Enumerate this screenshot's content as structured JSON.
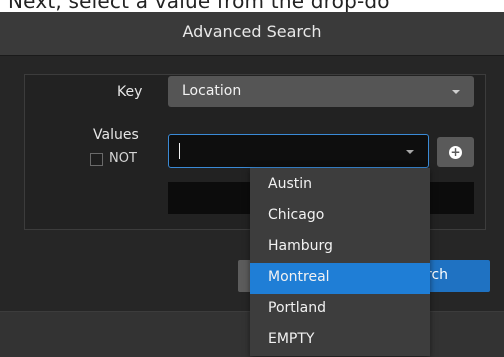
{
  "instruction_fragment": "Next, select a value from the drop-do",
  "dialog": {
    "title": "Advanced Search",
    "key_label": "Key",
    "values_label": "Values",
    "not_label": "NOT",
    "key_value": "Location",
    "values_input": "",
    "search_button_label": "rch"
  },
  "dropdown": {
    "options": [
      "Austin",
      "Chicago",
      "Hamburg",
      "Montreal",
      "Portland",
      "EMPTY"
    ],
    "selected": "Montreal"
  },
  "colors": {
    "accent": "#1f7ed6",
    "input_focus_border": "#3a8ad6",
    "dialog_header": "#3a3a3a"
  }
}
